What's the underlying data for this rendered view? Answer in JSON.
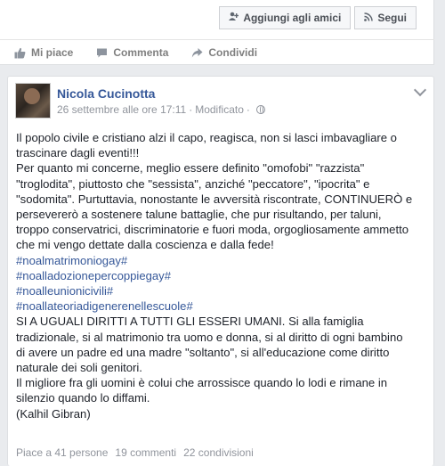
{
  "top": {
    "add_friend_label": "Aggiungi agli amici",
    "follow_label": "Segui"
  },
  "actions": {
    "like": "Mi piace",
    "comment": "Commenta",
    "share": "Condividi"
  },
  "post": {
    "author": "Nicola Cucinotta",
    "date": "26 settembre alle ore 17:11",
    "separator": "·",
    "modified": "Modificato",
    "lines": [
      {
        "text": "Il popolo civile e cristiano alzi il capo, reagisca, non si lasci imbavagliare o",
        "tag": false
      },
      {
        "text": "trascinare dagli eventi!!!",
        "tag": false
      },
      {
        "text": "Per quanto mi concerne, meglio essere definito \"omofobi\" \"razzista\"",
        "tag": false
      },
      {
        "text": "\"troglodita\", piuttosto che \"sessista\", anziché \"peccatore\", \"ipocrita\" e",
        "tag": false
      },
      {
        "text": "\"sodomita\". Purtuttavia, nonostante le avversità riscontrate, CONTINUERÒ e",
        "tag": false
      },
      {
        "text": "persevererò a sostenere talune battaglie, che pur risultando, per taluni,",
        "tag": false
      },
      {
        "text": "troppo conservatrici, discriminatorie e fuori moda, orgogliosamente ammetto",
        "tag": false
      },
      {
        "text": "che mi vengo dettate dalla coscienza e dalla fede!",
        "tag": false
      },
      {
        "text": "#noalmatrimoniogay#",
        "tag": true
      },
      {
        "text": "#noalladozionepercoppiegay#",
        "tag": true
      },
      {
        "text": "#noalleunionicivili#",
        "tag": true
      },
      {
        "text": "#noallateoriadigenerenellescuole#",
        "tag": true
      },
      {
        "text": "SI A UGUALI DIRITTI A TUTTI GLI ESSERI UMANI. Si alla famiglia",
        "tag": false
      },
      {
        "text": "tradizionale, si al matrimonio tra uomo e donna, si al diritto di ogni bambino",
        "tag": false
      },
      {
        "text": "di avere un padre ed una madre \"soltanto\", si all'educazione come diritto",
        "tag": false
      },
      {
        "text": "naturale dei soli genitori.",
        "tag": false
      },
      {
        "text": "Il migliore fra gli uomini è colui che arrossisce quando lo lodi e rimane in",
        "tag": false
      },
      {
        "text": "silenzio quando lo diffami.",
        "tag": false
      },
      {
        "text": "(Kalhil Gibran)",
        "tag": false
      }
    ],
    "stats": {
      "likes": "Piace a 41 persone",
      "comments": "19 commenti",
      "shares": "22 condivisioni"
    }
  }
}
